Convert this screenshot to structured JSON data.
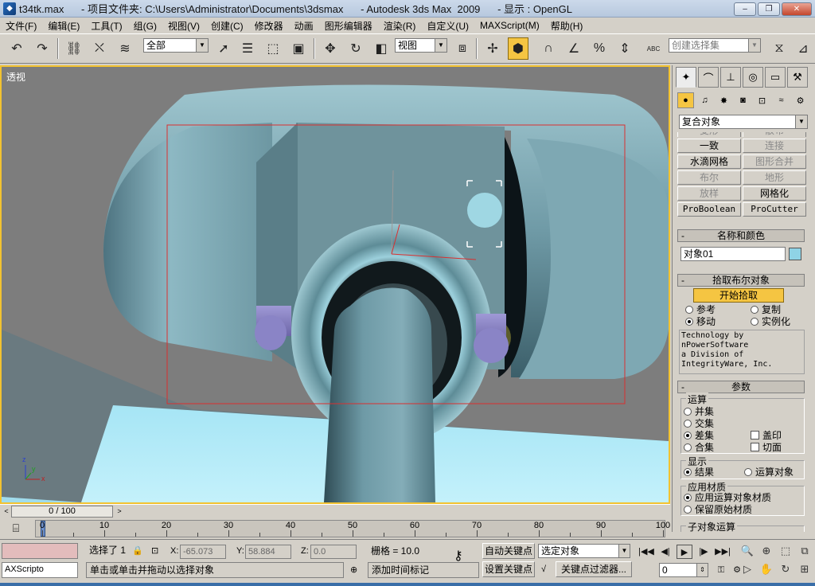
{
  "window": {
    "title": "t34tk.max      - 项目文件夹: C:\\Users\\Administrator\\Documents\\3dsmax      - Autodesk 3ds Max  2009      - 显示 : OpenGL",
    "app_icon": "3ds-max-icon",
    "minimize": "–",
    "maximize": "❐",
    "close": "✕"
  },
  "menu": [
    "文件(F)",
    "编辑(E)",
    "工具(T)",
    "组(G)",
    "视图(V)",
    "创建(C)",
    "修改器",
    "动画",
    "图形编辑器",
    "渲染(R)",
    "自定义(U)",
    "MAXScript(M)",
    "帮助(H)"
  ],
  "toolbar": {
    "selection_filter": "全部",
    "reference_coord": "视图",
    "named_selection_placeholder": "创建选择集",
    "abc_label": "ABC"
  },
  "viewport": {
    "label": "透视",
    "axis_labels": {
      "x": "x",
      "y": "y",
      "z": "z"
    }
  },
  "command_panel": {
    "category": "复合对象",
    "object_types": [
      [
        "变形",
        "散布"
      ],
      [
        "一致",
        "连接"
      ],
      [
        "水滴网格",
        "图形合并"
      ],
      [
        "布尔",
        "地形"
      ],
      [
        "放样",
        "网格化"
      ],
      [
        "ProBoolean",
        "ProCutter"
      ]
    ],
    "name_rollout": {
      "title": "名称和颜色",
      "object_name": "对象01",
      "color": "#8fd3e6"
    },
    "pick_rollout": {
      "title": "拾取布尔对象",
      "start_pick": "开始拾取",
      "options": [
        "参考",
        "复制",
        "移动",
        "实例化"
      ],
      "selected": "移动",
      "credits": "Technology by\nnPowerSoftware\na Division of\nIntegrityWare, Inc."
    },
    "params_rollout": {
      "title": "参数",
      "operation_group": "运算",
      "operations": [
        "并集",
        "交集",
        "差集",
        "合集"
      ],
      "selected_operation": "差集",
      "checkboxes": [
        "盖印",
        "切面"
      ],
      "display_group": "显示",
      "display_options": [
        "结果",
        "运算对象"
      ],
      "selected_display": "结果",
      "material_group": "应用材质",
      "material_options": [
        "应用运算对象材质",
        "保留原始材质"
      ],
      "selected_material": "应用运算对象材质",
      "subobject_group": "子对象运算"
    },
    "rollout_toggle": "-"
  },
  "timeline": {
    "slider_text": "0 / 100",
    "prev": "<",
    "next": ">",
    "ticks": [
      0,
      10,
      20,
      30,
      40,
      50,
      60,
      70,
      80,
      90,
      100
    ]
  },
  "status": {
    "selected_text": "选择了 1",
    "x_label": "X:",
    "x_value": "-65.073",
    "y_label": "Y:",
    "y_value": "58.884",
    "z_label": "Z:",
    "z_value": "0.0",
    "grid": "栅格 = 10.0",
    "auto_key": "自动关键点",
    "set_key": "设置关键点",
    "key_mode_select": "选定对象",
    "key_filters": "关键点过滤器...",
    "frame_value": "0",
    "maxscript": "AXScripto",
    "prompt": "单击或单击并拖动以选择对象",
    "add_time_tag": "添加时间标记"
  }
}
